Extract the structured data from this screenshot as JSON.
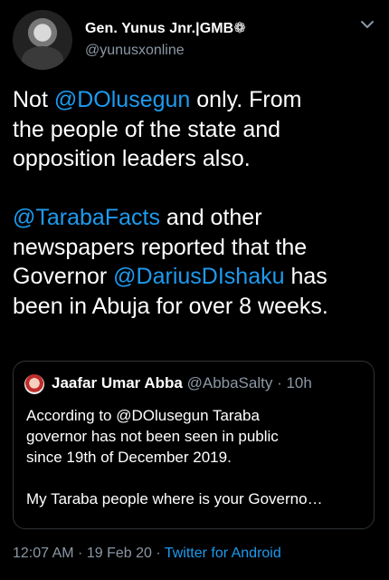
{
  "author": {
    "display_name": "Gen. Yunus Jnr.|GMB❁",
    "handle": "@yunusxonline"
  },
  "tweet": {
    "t1": "Not ",
    "m1": "@DOlusegun",
    "t2": " only. From\nthe people of the state and\nopposition leaders also.\n\n",
    "m2": "@TarabaFacts",
    "t3": " and other\nnewspapers reported that the\nGovernor ",
    "m3": "@DariusDIshaku",
    "t4": " has\nbeen in Abuja for over 8 weeks."
  },
  "quoted": {
    "name": "Jaafar Umar Abba",
    "meta": " @AbbaSalty · 10h",
    "text": "According to @DOlusegun Taraba\ngovernor has not been seen in public\nsince 19th of December 2019.\n\nMy Taraba people where is your Governo…"
  },
  "footer": {
    "timestamp": "12:07 AM · 19 Feb 20 · ",
    "source": "Twitter for Android"
  },
  "colors": {
    "accent": "#1d9bf0",
    "muted": "#8b98a5",
    "background": "#000000"
  },
  "icons": {
    "menu": "chevron-down-icon"
  }
}
